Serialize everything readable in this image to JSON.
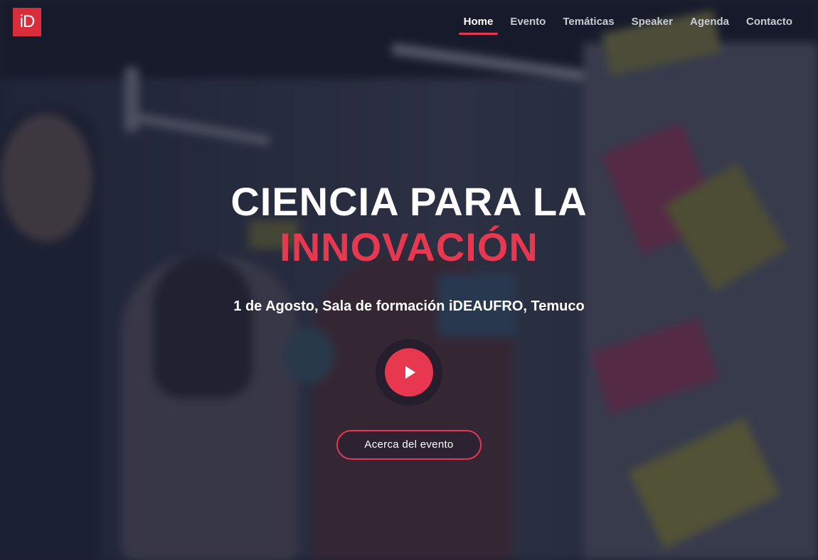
{
  "brand": {
    "logo_text": "iD",
    "logo_color": "#d92d3c"
  },
  "nav": {
    "items": [
      {
        "label": "Home",
        "active": true
      },
      {
        "label": "Evento",
        "active": false
      },
      {
        "label": "Temáticas",
        "active": false
      },
      {
        "label": "Speaker",
        "active": false
      },
      {
        "label": "Agenda",
        "active": false
      },
      {
        "label": "Contacto",
        "active": false
      }
    ]
  },
  "hero": {
    "title_line1": "CIENCIA PARA LA",
    "title_line2": "INNOVACIÓN",
    "subtitle": "1 de Agosto, Sala de formación iDEAUFRO, Temuco",
    "play_icon": "play-icon",
    "cta_label": "Acerca del evento"
  },
  "colors": {
    "accent": "#e8384f",
    "text": "#ffffff",
    "nav_inactive": "#c9cbd3"
  }
}
